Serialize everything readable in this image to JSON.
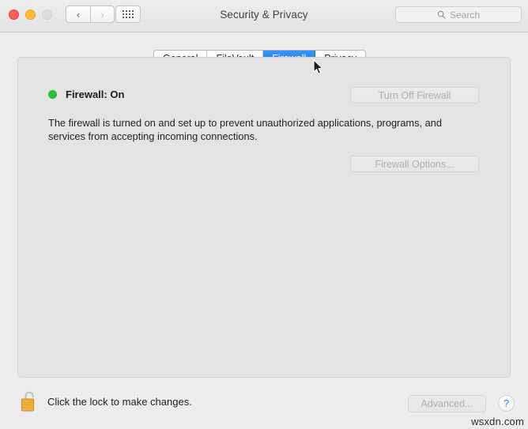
{
  "window": {
    "title": "Security & Privacy",
    "traffic_lights": [
      {
        "name": "close",
        "color": "#ff5f57"
      },
      {
        "name": "minimize",
        "color": "#ffbd2e"
      },
      {
        "name": "zoom",
        "color": "#dddddd"
      }
    ],
    "nav": {
      "back_label": "‹",
      "forward_label": "›",
      "grid_label": "show-all-grid"
    }
  },
  "search": {
    "placeholder": "Search",
    "icon": "search-icon"
  },
  "tabs": [
    {
      "id": "general",
      "label": "General",
      "active": false
    },
    {
      "id": "filevault",
      "label": "FileVault",
      "active": false
    },
    {
      "id": "firewall",
      "label": "Firewall",
      "active": true
    },
    {
      "id": "privacy",
      "label": "Privacy",
      "active": false
    }
  ],
  "firewall": {
    "status_label": "Firewall: On",
    "status_color": "#2ac034",
    "description": "The firewall is turned on and set up to prevent unauthorized applications, programs, and services from accepting incoming connections.",
    "turn_off_button": "Turn Off Firewall",
    "options_button": "Firewall Options..."
  },
  "footer": {
    "lock_icon": "unlocked-padlock-icon",
    "lock_message": "Click the lock to make changes.",
    "advanced_button": "Advanced...",
    "help_button": "?"
  },
  "watermark": "wsxdn.com",
  "colors": {
    "accent_blue": "#147bf3",
    "window_bg": "#ececec",
    "panel_bg": "#e3e3e3",
    "lock_gold": "#f0b23c"
  }
}
